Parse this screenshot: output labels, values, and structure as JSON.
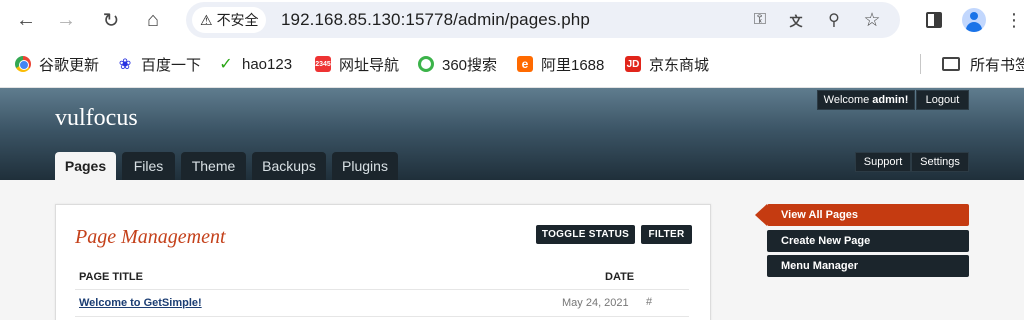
{
  "browser": {
    "security_label": "不安全",
    "url": "192.168.85.130:15778/admin/pages.php",
    "nav_icons": {
      "back": "arrow-left-icon",
      "forward": "arrow-right-icon",
      "reload": "reload-icon",
      "home": "home-icon"
    },
    "address_icons": [
      "key-icon",
      "translate-icon",
      "zoom-icon",
      "star-icon"
    ],
    "bookmarks": [
      {
        "label": "谷歌更新",
        "icon": "chrome-icon"
      },
      {
        "label": "百度一下",
        "icon": "baidu-paw-icon"
      },
      {
        "label": "hao123",
        "icon": "hao123-icon"
      },
      {
        "label": "网址导航",
        "icon": "2345-icon"
      },
      {
        "label": "360搜索",
        "icon": "360-icon"
      },
      {
        "label": "阿里1688",
        "icon": "alibaba-icon"
      },
      {
        "label": "京东商城",
        "icon": "jd-icon"
      }
    ],
    "all_bookmarks_label": "所有书签"
  },
  "header": {
    "site_name": "vulfocus",
    "welcome_prefix": "Welcome",
    "welcome_user": "admin!",
    "logout_label": "Logout",
    "tabs": [
      {
        "label": "Pages",
        "active": true
      },
      {
        "label": "Files",
        "active": false
      },
      {
        "label": "Theme",
        "active": false
      },
      {
        "label": "Backups",
        "active": false
      },
      {
        "label": "Plugins",
        "active": false
      }
    ],
    "support_label": "Support",
    "settings_label": "Settings"
  },
  "main": {
    "title": "Page Management",
    "toggle_status_label": "TOGGLE STATUS",
    "filter_label": "FILTER",
    "columns": {
      "title": "PAGE TITLE",
      "date": "DATE"
    },
    "rows": [
      {
        "title": "Welcome to GetSimple!",
        "date": "May 24, 2021",
        "extra": "#"
      }
    ]
  },
  "sidebar": {
    "items": [
      {
        "label": "View All Pages",
        "active": true
      },
      {
        "label": "Create New Page",
        "active": false
      },
      {
        "label": "Menu Manager",
        "active": false
      }
    ]
  },
  "colors": {
    "accent": "#c53b11",
    "dark_button": "#1b252c",
    "header_top": "#5f7c8e",
    "link": "#1b3d73"
  }
}
